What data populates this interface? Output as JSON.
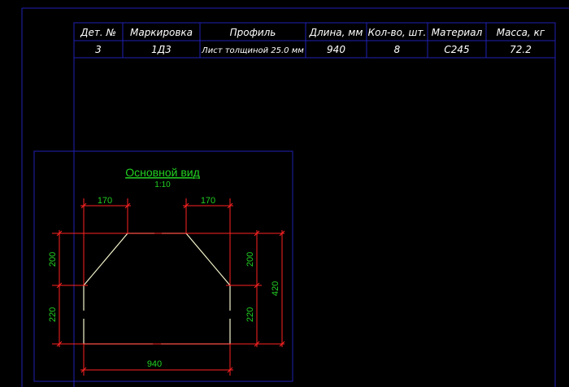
{
  "colors": {
    "background": "#000000",
    "frame": "#1f1fb4",
    "table_text": "#ffffff",
    "outline": "#f4f4cc",
    "dimension": "#ff2222",
    "dim_text": "#22d022",
    "title": "#22d022"
  },
  "spec_table": {
    "headers": [
      "Дет. №",
      "Маркировка",
      "Профиль",
      "Длина, мм",
      "Кол-во, шт.",
      "Материал",
      "Масса, кг"
    ],
    "row": [
      "3",
      "1Д3",
      "Лист толщиной 25.0 мм",
      "940",
      "8",
      "С245",
      "72.2"
    ]
  },
  "view": {
    "title": "Основной вид",
    "scale": "1:10"
  },
  "dimensions": {
    "top_left": "170",
    "top_right": "170",
    "left_upper": "200",
    "left_lower": "220",
    "right_upper": "200",
    "right_lower": "220",
    "overall_height": "420",
    "overall_width": "940"
  }
}
